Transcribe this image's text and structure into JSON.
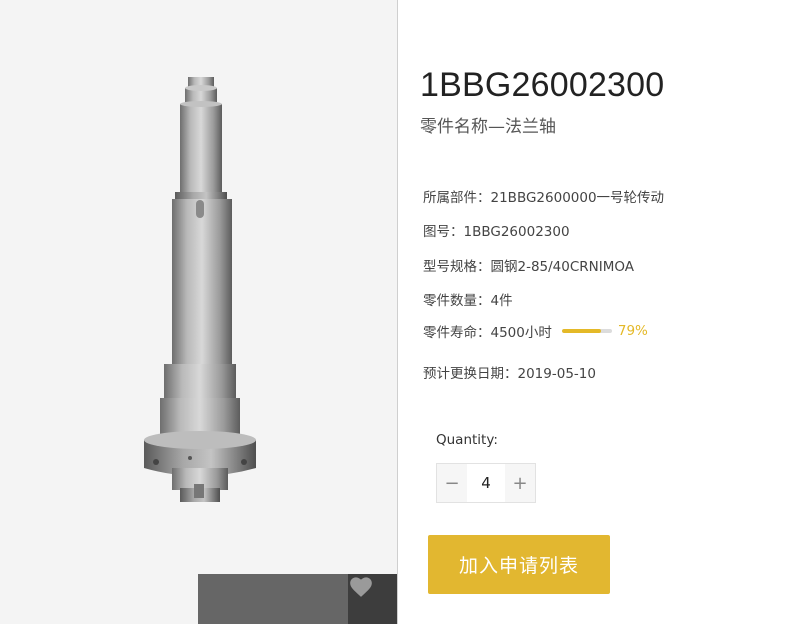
{
  "product": {
    "part_number": "1BBG26002300",
    "part_name": "零件名称—法兰轴"
  },
  "attributes": {
    "assembly": "所属部件：21BBG2600000一号轮传动",
    "drawing_no": "图号：1BBG26002300",
    "model_spec": "型号规格：圆钢2-85/40CRNIMOA",
    "quantity_count": "零件数量：4件",
    "life_label": "零件寿命：4500小时",
    "life_percent_text": "79%",
    "life_fraction": 0.79,
    "replace_date": "预计更换日期：2019-05-10"
  },
  "quantity": {
    "label": "Quantity:",
    "value": "4",
    "minus": "−",
    "plus": "+"
  },
  "actions": {
    "add_label": "加入申请列表"
  },
  "colors": {
    "accent": "#e2b730",
    "favorite_bg": "#3d3d3d"
  },
  "icons": {
    "favorite": "heart-icon",
    "product_image": "flange-shaft-image"
  }
}
